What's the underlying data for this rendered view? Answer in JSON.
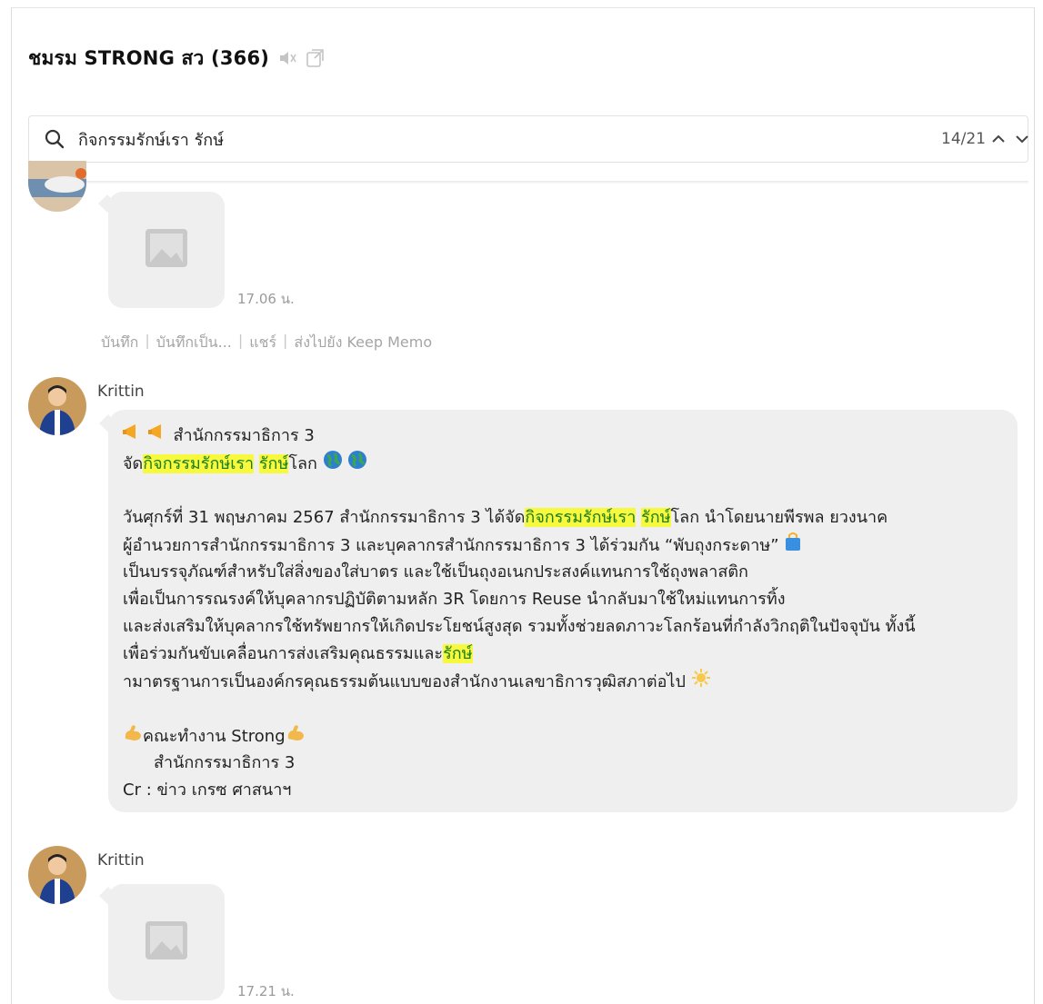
{
  "chat": {
    "title": "ชมรม STRONG สว (366)",
    "icons": [
      "mute-icon",
      "popout-icon"
    ]
  },
  "search": {
    "query": "กิจกรรมรักษ์เรา รักษ์",
    "count": "14/21"
  },
  "messages": {
    "m1": {
      "time": "17.06 น."
    },
    "actions": {
      "save": "บันทึก",
      "save_as": "บันทึกเป็น...",
      "share": "แชร์",
      "keep": "ส่งไปยัง Keep Memo",
      "sep": "|"
    },
    "m2": {
      "sender": "Krittin",
      "l1": "สำนักกรรมาธิการ 3",
      "l2a": "จัด",
      "l2b": "กิจกรรมรักษ์เรา",
      "l2c": " ",
      "l2d": "รักษ์",
      "l2e": "โลก",
      "l3a": "วันศุกร์ที่ 31 พฤษภาคม 2567 สำนักกรรมาธิการ 3 ได้จัด",
      "l3b": "กิจกรรมรักษ์เรา",
      "l3c": " ",
      "l3d": "รักษ์",
      "l3e": "โลก นำโดยนายพีรพล  ยวงนาค",
      "l4": "ผู้อำนวยการสำนักกรรมาธิการ 3 และบุคลากรสำนักกรรมาธิการ 3 ได้ร่วมกัน “พับถุงกระดาษ”",
      "l5": "เป็นบรรจุภัณฑ์สำหรับใส่สิ่งของใส่บาตร และใช้เป็นถุงอเนกประสงค์แทนการใช้ถุงพลาสติก",
      "l6": "เพื่อเป็นการรณรงค์ให้บุคลากรปฏิบัติตามหลัก 3R โดยการ Reuse นำกลับมาใช้ใหม่แทนการทิ้ง",
      "l7": "และส่งเสริมให้บุคลากรใช้ทรัพยากรให้เกิดประโยชน์สูงสุด รวมทั้งช่วยลดภาวะโลกร้อนที่กำลังวิกฤติในปัจจุบัน ทั้งนี้",
      "l8a": "เพื่อร่วมกันขับเคลื่อนการส่งเสริมคุณธรรมและ",
      "l8b": "รักษ์",
      "l9": "ามาตรฐานการเป็นองค์กรคุณธรรมต้นแบบของสำนักงานเลขาธิการวุฒิสภาต่อไป",
      "l10": "คณะทำงาน Strong",
      "l11": "สำนักกรรมาธิการ 3",
      "l12": "Cr : ข่าว เกรซ ศาสนาฯ"
    },
    "m3": {
      "sender": "Krittin",
      "time": "17.21 น."
    }
  }
}
